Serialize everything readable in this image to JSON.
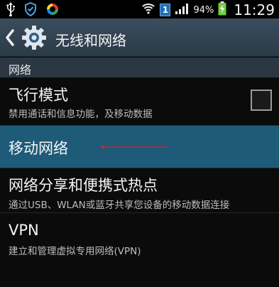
{
  "status_bar": {
    "icons": [
      "usb-icon",
      "shield-icon",
      "app-ring-icon",
      "wifi-icon",
      "signal-icon",
      "battery-charging-icon"
    ],
    "sim_slot": "1",
    "battery_percent": "94%",
    "time": "11:29"
  },
  "action_bar": {
    "title": "无线和网络"
  },
  "section": {
    "label": "网络"
  },
  "settings": [
    {
      "title": "飞行模式",
      "subtitle": "禁用通话和信息功能，及移动数据",
      "checked": false
    },
    {
      "title": "移动网络"
    },
    {
      "title": "网络分享和便携式热点",
      "subtitle": "通过USB、WLAN或蓝牙共享您设备的移动数据连接"
    },
    {
      "title": "VPN",
      "subtitle": "建立和管理虚拟专用网络(VPN)"
    }
  ],
  "colors": {
    "selected_row": "#1e5b78",
    "action_bar": "#34495a",
    "pointer": "#e0202a"
  }
}
